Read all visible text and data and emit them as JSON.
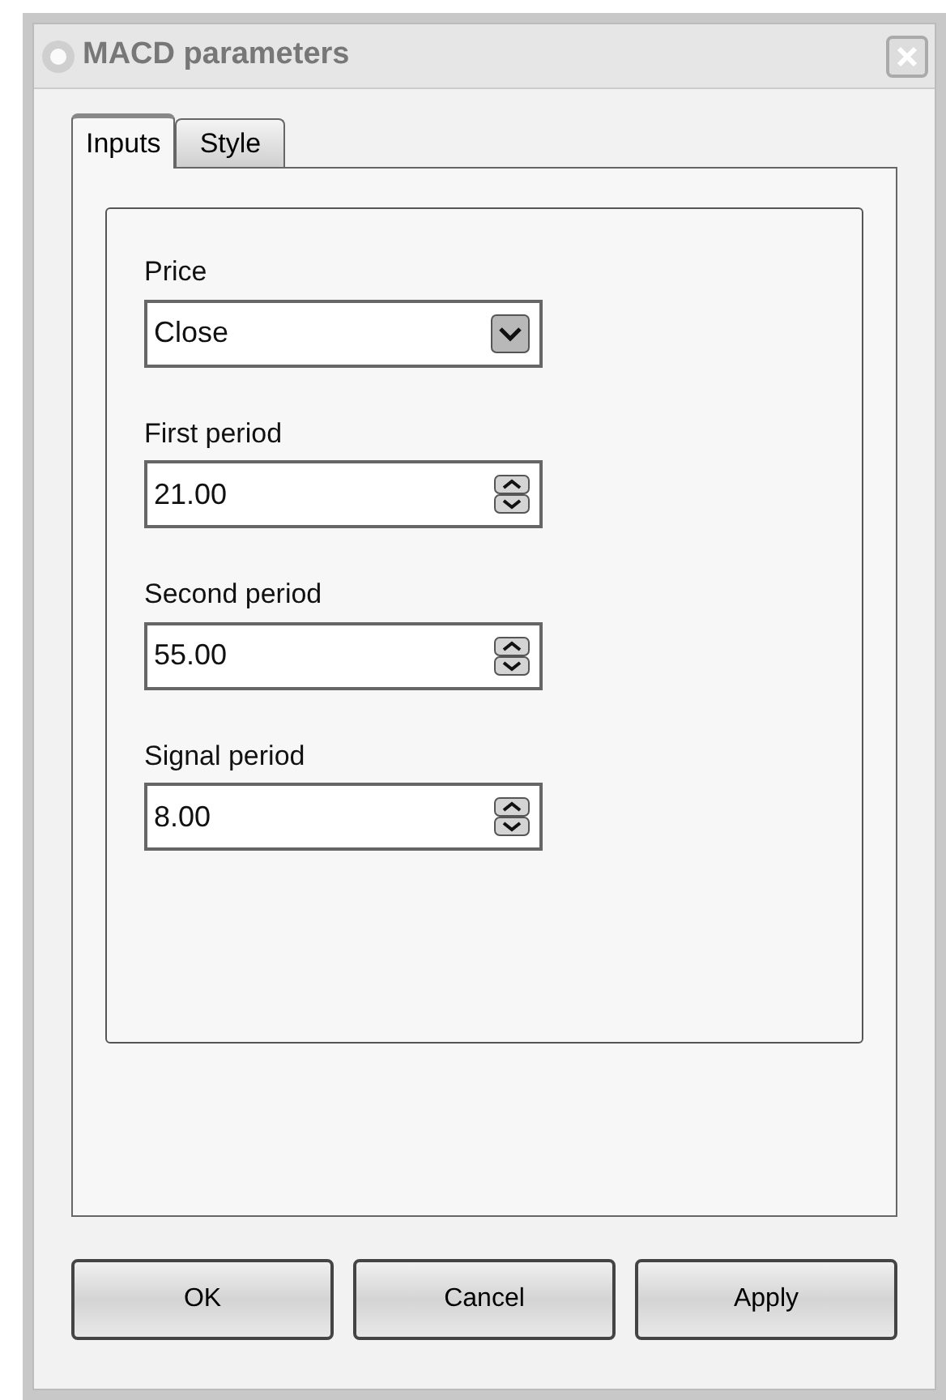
{
  "window": {
    "title": "MACD parameters"
  },
  "tabs": [
    {
      "label": "Inputs",
      "selected": true
    },
    {
      "label": "Style",
      "selected": false
    }
  ],
  "fields": [
    {
      "kind": "select",
      "label": "Price",
      "value": "Close"
    },
    {
      "kind": "spinner",
      "label": "First period",
      "value": "21.00"
    },
    {
      "kind": "spinner",
      "label": "Second period",
      "value": "55.00"
    },
    {
      "kind": "spinner",
      "label": "Signal period",
      "value": "8.00"
    }
  ],
  "buttons": [
    "OK",
    "Cancel",
    "Apply"
  ]
}
